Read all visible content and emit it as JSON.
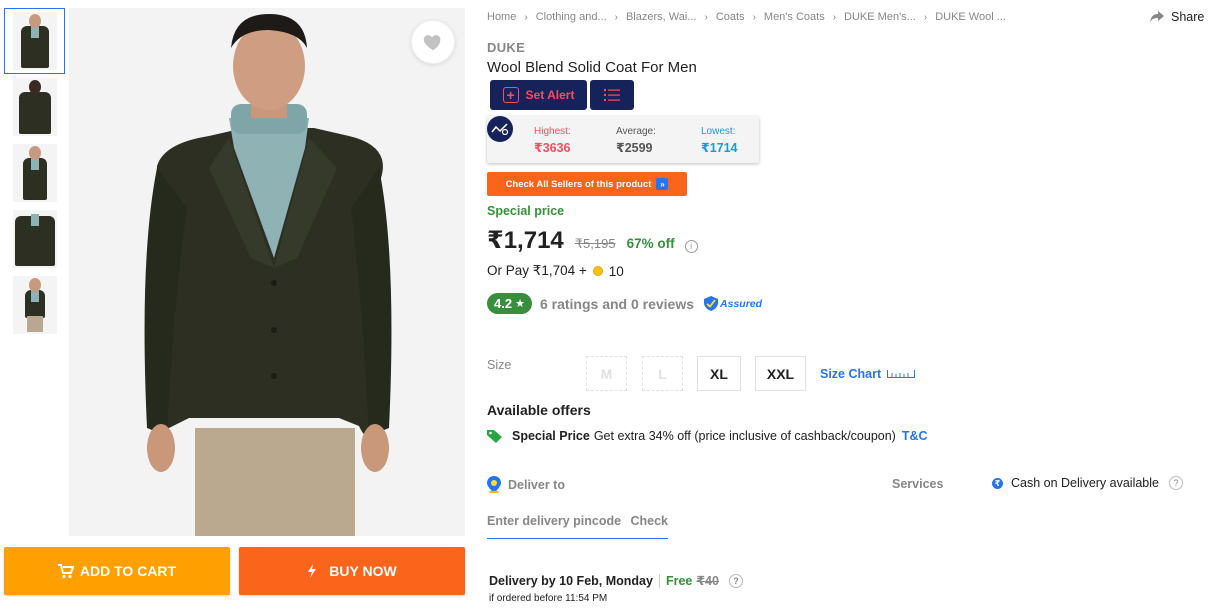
{
  "thumbnails": [
    {
      "alt": "thumb-1"
    },
    {
      "alt": "thumb-2"
    },
    {
      "alt": "thumb-3"
    },
    {
      "alt": "thumb-4"
    },
    {
      "alt": "thumb-5"
    }
  ],
  "actions": {
    "add_to_cart": "ADD TO CART",
    "buy_now": "BUY NOW"
  },
  "breadcrumb": [
    "Home",
    "Clothing and...",
    "Blazers, Wai...",
    "Coats",
    "Men's Coats",
    "DUKE Men's...",
    "DUKE Wool ..."
  ],
  "share_label": "Share",
  "product": {
    "brand": "DUKE",
    "title": "Wool Blend Solid Coat For Men"
  },
  "tracker": {
    "set_alert": "Set Alert",
    "highest_label": "Highest:",
    "highest_value": "₹3636",
    "average_label": "Average:",
    "average_value": "₹2599",
    "lowest_label": "Lowest:",
    "lowest_value": "₹1714",
    "check_sellers": "Check All Sellers of this product"
  },
  "pricing": {
    "special_label": "Special price",
    "price": "₹1,714",
    "mrp": "₹5,195",
    "discount": "67% off",
    "or_pay_prefix": "Or Pay ₹1,704 +",
    "or_pay_coins": "10"
  },
  "rating": {
    "score": "4.2",
    "text": "6 ratings and 0 reviews",
    "assured": "Assured"
  },
  "sizes": {
    "label": "Size",
    "options": [
      "M",
      "L",
      "XL",
      "XXL"
    ],
    "size_chart": "Size Chart"
  },
  "offers": {
    "title": "Available offers",
    "items": [
      {
        "type": "Special Price",
        "text": "Get extra 34% off (price inclusive of cashback/coupon)",
        "link": "T&C"
      }
    ]
  },
  "delivery": {
    "deliver_to": "Deliver to",
    "services_label": "Services",
    "cod": "Cash on Delivery available",
    "pincode_placeholder": "Enter delivery pincode",
    "check": "Check",
    "date": "Delivery by 10 Feb, Monday",
    "free": "Free",
    "fee": "₹40",
    "order_before": "if ordered before 11:54 PM"
  },
  "colors": {
    "primary_blue": "#2874f0",
    "cart_orange": "#ff9f00",
    "buy_orange": "#fb641b",
    "green": "#388e3c",
    "navy": "#16225a",
    "alert_red": "#ff4d5e"
  }
}
